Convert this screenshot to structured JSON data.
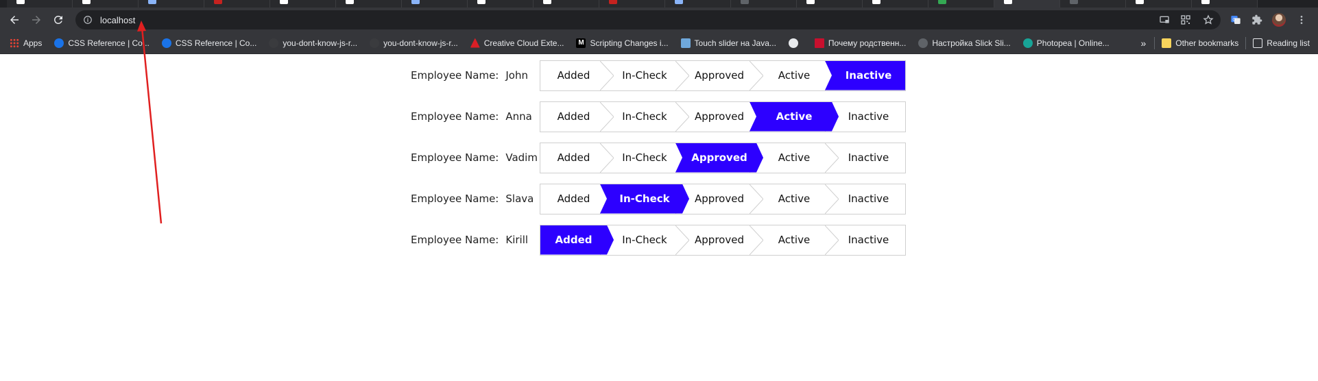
{
  "browser": {
    "url": "localhost",
    "bookmarks": [
      {
        "label": "Apps",
        "icon": "apps-grid-icon"
      },
      {
        "label": "CSS Reference | Co...",
        "icon": "drop-icon"
      },
      {
        "label": "CSS Reference | Co...",
        "icon": "drop-icon"
      },
      {
        "label": "you-dont-know-js-r...",
        "icon": "github-icon"
      },
      {
        "label": "you-dont-know-js-r...",
        "icon": "github-icon"
      },
      {
        "label": "Creative Cloud Exte...",
        "icon": "adobe-icon"
      },
      {
        "label": "Scripting Changes i...",
        "icon": "medium-icon"
      },
      {
        "label": "Touch slider на Java...",
        "icon": "touch-icon"
      },
      {
        "label": "",
        "icon": "globe-icon"
      },
      {
        "label": "Почему родственн...",
        "icon": "sm-icon"
      },
      {
        "label": "Настройка Slick Sli...",
        "icon": "paw-icon"
      },
      {
        "label": "Photopea | Online...",
        "icon": "photopea-icon"
      }
    ],
    "overflow_label": "»",
    "other_bookmarks": "Other bookmarks",
    "reading_list": "Reading list"
  },
  "page": {
    "label_prefix": "Employee Name:",
    "statuses": [
      "Added",
      "In-Check",
      "Approved",
      "Active",
      "Inactive"
    ],
    "accent_color": "#2d00ff",
    "employees": [
      {
        "name": "John",
        "active_index": 4
      },
      {
        "name": "Anna",
        "active_index": 3
      },
      {
        "name": "Vadim",
        "active_index": 2
      },
      {
        "name": "Slava",
        "active_index": 1
      },
      {
        "name": "Kirill",
        "active_index": 0
      }
    ]
  }
}
